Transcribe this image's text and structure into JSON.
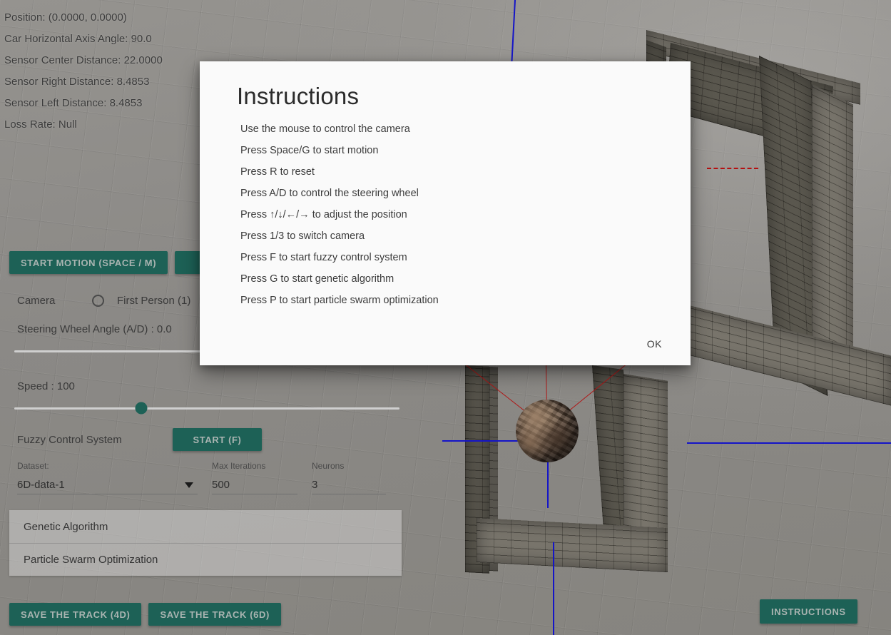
{
  "hud": {
    "lines": [
      "Position: (0.0000, 0.0000)",
      "Car Horizontal Axis Angle: 90.0",
      "Sensor Center Distance: 22.0000",
      "Sensor Right Distance: 8.4853",
      "Sensor Left Distance: 8.4853",
      "Loss Rate: Null"
    ]
  },
  "controls": {
    "start_motion_label": "START MOTION (SPACE / M)",
    "camera_label": "Camera",
    "camera_option_label": "First Person (1)",
    "camera_selected": false,
    "steering_label": "Steering Wheel Angle (A/D) : 0.0",
    "steering_value": 0.0,
    "speed_label": "Speed : 100",
    "speed_value": 100,
    "fuzzy_label": "Fuzzy Control System",
    "fuzzy_start_label": "START (F)",
    "dataset_label": "Dataset:",
    "dataset_value": "6D-data-1",
    "max_iterations_label": "Max Iterations",
    "max_iterations_value": "500",
    "neurons_label": "Neurons",
    "neurons_value": "3",
    "panels": [
      {
        "label": "Genetic Algorithm"
      },
      {
        "label": "Particle Swarm Optimization"
      }
    ],
    "save_track_4d_label": "SAVE THE TRACK (4D)",
    "save_track_6d_label": "SAVE THE TRACK (6D)",
    "instructions_btn_label": "INSTRUCTIONS"
  },
  "dialog": {
    "title": "Instructions",
    "items": [
      "Use the mouse to control the camera",
      "Press Space/G to start motion",
      "Press R to reset",
      "Press A/D to control the steering wheel",
      "Press ↑/↓/←/→ to adjust the position",
      "Press 1/3 to switch camera",
      "Press F to start fuzzy control system",
      "Press G to start genetic algorithm",
      "Press P to start particle swarm optimization"
    ],
    "ok_label": "OK"
  },
  "colors": {
    "accent_teal": "#1d6156",
    "axis_blue": "#1414c8",
    "sensor_red": "#b01616",
    "wall_brick": "#5d5a51",
    "floor_grey": "#8b8986"
  }
}
